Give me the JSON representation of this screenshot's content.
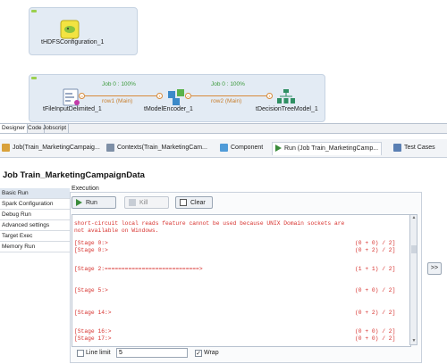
{
  "designer": {
    "components": [
      {
        "label": "tHDFSConfiguration_1",
        "icon": "hdfs-configuration-icon"
      },
      {
        "label": "tFileInputDelimited_1",
        "icon": "file-input-delimited-icon"
      },
      {
        "label": "tModelEncoder_1",
        "icon": "model-encoder-icon"
      },
      {
        "label": "tDecisionTreeModel_1",
        "icon": "decision-tree-model-icon"
      }
    ],
    "links": [
      {
        "row": "row1 (Main)",
        "job": "Job 0 : 100%"
      },
      {
        "row": "row2 (Main)",
        "job": "Job 0 : 100%"
      }
    ]
  },
  "designer_tabs": [
    "Designer",
    "Code",
    "Jobscript"
  ],
  "view_tabs": [
    {
      "label": "Job(Train_MarketingCampaig...",
      "icon": "job-icon"
    },
    {
      "label": "Contexts(Train_MarketingCam...",
      "icon": "contexts-icon"
    },
    {
      "label": "Component",
      "icon": "component-icon"
    },
    {
      "label": "Run (Job Train_MarketingCamp...",
      "icon": "run-icon"
    },
    {
      "label": "Test Cases",
      "icon": "test-cases-icon"
    }
  ],
  "job_title": "Job Train_MarketingCampaignData",
  "run_nav": [
    "Basic Run",
    "Spark Configuration",
    "Debug Run",
    "Advanced settings",
    "Target Exec",
    "Memory Run"
  ],
  "execution": {
    "label": "Execution",
    "run_label": "Run",
    "kill_label": "Kill",
    "clear_label": "Clear"
  },
  "console": {
    "warning_line1": "short-circuit local reads feature cannot be used because UNIX Domain sockets are",
    "warning_line2": "not available on Windows.",
    "lines": [
      {
        "left": "[Stage 0:>",
        "right": "(0 + 0) / 2]"
      },
      {
        "left": "[Stage 0:>",
        "right": "(0 + 2) / 2]"
      },
      {
        "left": "[Stage 2:============================>",
        "right": "(1 + 1) / 2]"
      },
      {
        "left": "[Stage 5:>",
        "right": "(0 + 0) / 2]"
      },
      {
        "left": "[Stage 14:>",
        "right": "(0 + 2) / 2]"
      },
      {
        "left": "[Stage 16:>",
        "right": "(0 + 0) / 2]"
      },
      {
        "left": "[Stage 17:>",
        "right": "(0 + 0) / 2]"
      }
    ]
  },
  "expand_label": ">>",
  "options": {
    "line_limit_label": "Line limit",
    "line_limit_value": "5",
    "line_limit_checked": false,
    "wrap_label": "Wrap",
    "wrap_checked": true
  },
  "colors": {
    "console_text": "#d7322e",
    "link": "#d78a3a",
    "job_progress": "#3c9a3c",
    "subjob_bg": "#e3ebf4"
  }
}
